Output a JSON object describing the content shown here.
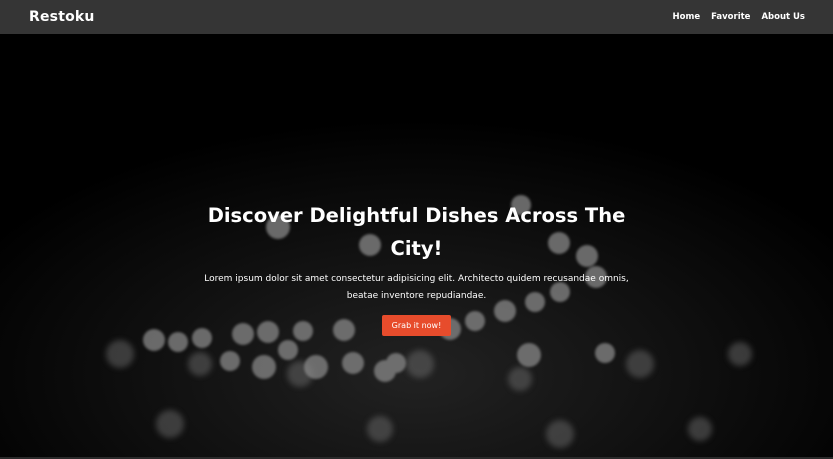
{
  "navbar": {
    "brand": "Restoku",
    "links": [
      "Home",
      "Favorite",
      "About Us"
    ]
  },
  "hero": {
    "title": "Discover Delightful Dishes Across The City!",
    "description": "Lorem ipsum dolor sit amet consectetur adipisicing elit. Architecto quidem recusandae omnis, beatae inventore repudiandae.",
    "cta_label": "Grab it now!"
  },
  "colors": {
    "navbar_bg": "#353535",
    "hero_bg": "#000000",
    "cta_bg": "#e74c2c"
  }
}
